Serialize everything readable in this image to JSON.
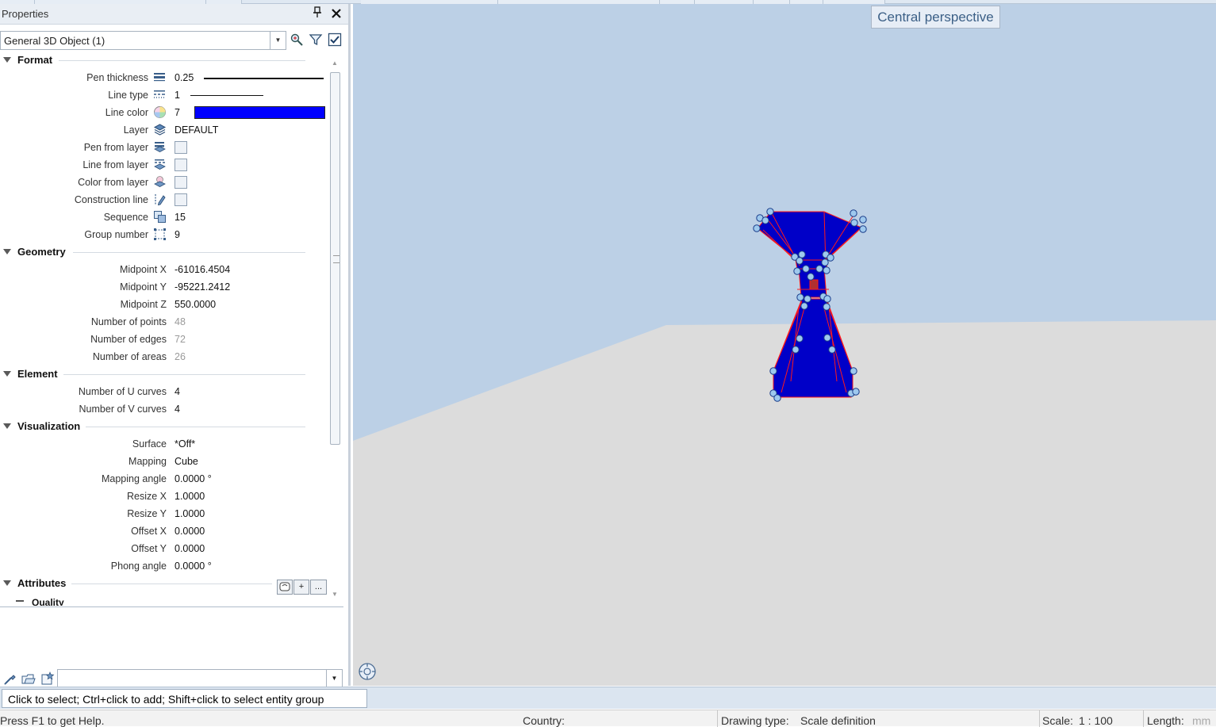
{
  "panel": {
    "title": "Properties",
    "object_selector": "General 3D Object (1)"
  },
  "sections": {
    "format": "Format",
    "geometry": "Geometry",
    "element": "Element",
    "visualization": "Visualization",
    "attributes": "Attributes",
    "quality": "Quality"
  },
  "format": {
    "pen_thickness": {
      "label": "Pen thickness",
      "value": "0.25",
      "icon": "pen-thickness-icon"
    },
    "line_type": {
      "label": "Line type",
      "value": "1",
      "icon": "line-type-icon"
    },
    "line_color": {
      "label": "Line color",
      "value": "7",
      "swatch": "#0000ff",
      "icon": "color-wheel-icon"
    },
    "layer": {
      "label": "Layer",
      "value": "DEFAULT",
      "icon": "layers-icon"
    },
    "pen_from_layer": {
      "label": "Pen from layer",
      "checked": false,
      "icon": "pen-from-layer-icon"
    },
    "line_from_layer": {
      "label": "Line from layer",
      "checked": false,
      "icon": "line-from-layer-icon"
    },
    "color_from_layer": {
      "label": "Color from layer",
      "checked": false,
      "icon": "color-from-layer-icon"
    },
    "construction_line": {
      "label": "Construction line",
      "checked": false,
      "icon": "construction-line-icon"
    },
    "sequence": {
      "label": "Sequence",
      "value": "15",
      "icon": "sequence-icon"
    },
    "group_number": {
      "label": "Group number",
      "value": "9",
      "icon": "group-icon"
    }
  },
  "geometry": {
    "midpoint_x": {
      "label": "Midpoint X",
      "value": "-61016.4504"
    },
    "midpoint_y": {
      "label": "Midpoint Y",
      "value": "-95221.2412"
    },
    "midpoint_z": {
      "label": "Midpoint Z",
      "value": "550.0000"
    },
    "num_points": {
      "label": "Number of points",
      "value": "48"
    },
    "num_edges": {
      "label": "Number of edges",
      "value": "72"
    },
    "num_areas": {
      "label": "Number of areas",
      "value": "26"
    }
  },
  "element": {
    "u_curves": {
      "label": "Number of U curves",
      "value": "4"
    },
    "v_curves": {
      "label": "Number of V curves",
      "value": "4"
    }
  },
  "visualization": {
    "surface": {
      "label": "Surface",
      "value": "*Off*"
    },
    "mapping": {
      "label": "Mapping",
      "value": "Cube"
    },
    "mapping_angle": {
      "label": "Mapping angle",
      "value": "0.0000 °"
    },
    "resize_x": {
      "label": "Resize X",
      "value": "1.0000"
    },
    "resize_y": {
      "label": "Resize Y",
      "value": "1.0000"
    },
    "offset_x": {
      "label": "Offset X",
      "value": "0.0000"
    },
    "offset_y": {
      "label": "Offset Y",
      "value": "0.0000"
    },
    "phong_angle": {
      "label": "Phong angle",
      "value": "0.0000 °"
    }
  },
  "attributes_buttons": {
    "add": "+",
    "more": "..."
  },
  "viewport": {
    "title": "Central perspective",
    "colors": {
      "sky": "#bcd0e6",
      "ground": "#dcdcdc",
      "object": "#0000c8",
      "edges": "#ff1a1a",
      "handles": "#9ec9ee"
    }
  },
  "prompt": "Click to select; Ctrl+click to add; Shift+click to select entity group",
  "status": {
    "help": "Press F1 to get Help.",
    "country_label": "Country:",
    "country_value": "",
    "drawing_type_label": "Drawing type:",
    "drawing_type_value": "Scale definition",
    "scale_label": "Scale:",
    "scale_value": "1 : 100",
    "length_label": "Length:",
    "length_value": "mm"
  }
}
